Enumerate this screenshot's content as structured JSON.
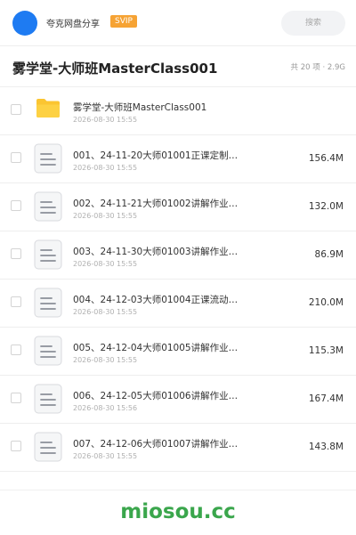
{
  "header": {
    "uploader_name": "夸克网盘分享",
    "vip_label": "SVIP",
    "search_label": "搜索"
  },
  "folder_header": {
    "title": "雾学堂-大师班MasterClass001",
    "count_label": "共 20 项",
    "size_label": "2.9G"
  },
  "files": [
    {
      "name": "雾学堂-大师班MasterClass001",
      "date": "2026-08-30 15:55",
      "size": "",
      "type": "folder-icon"
    },
    {
      "name": "001、24-11-20大师01001正课定制…",
      "date": "2026-08-30 15:55",
      "size": "156.4M",
      "type": "document-icon"
    },
    {
      "name": "002、24-11-21大师01002讲解作业…",
      "date": "2026-08-30 15:55",
      "size": "132.0M",
      "type": "document-icon"
    },
    {
      "name": "003、24-11-30大师01003讲解作业…",
      "date": "2026-08-30 15:55",
      "size": "86.9M",
      "type": "document-icon"
    },
    {
      "name": "004、24-12-03大师01004正课流动…",
      "date": "2026-08-30 15:55",
      "size": "210.0M",
      "type": "document-icon"
    },
    {
      "name": "005、24-12-04大师01005讲解作业…",
      "date": "2026-08-30 15:55",
      "size": "115.3M",
      "type": "document-icon"
    },
    {
      "name": "006、24-12-05大师01006讲解作业…",
      "date": "2026-08-30 15:56",
      "size": "167.4M",
      "type": "document-icon"
    },
    {
      "name": "007、24-12-06大师01007讲解作业…",
      "date": "2026-08-30 15:55",
      "size": "143.8M",
      "type": "document-icon"
    }
  ],
  "watermark": "miosou.cc",
  "colors": {
    "avatar": "#1e7bf2",
    "vip_badge": "#f6a334",
    "folder": "#fbc531",
    "watermark": "#3aa64c"
  }
}
